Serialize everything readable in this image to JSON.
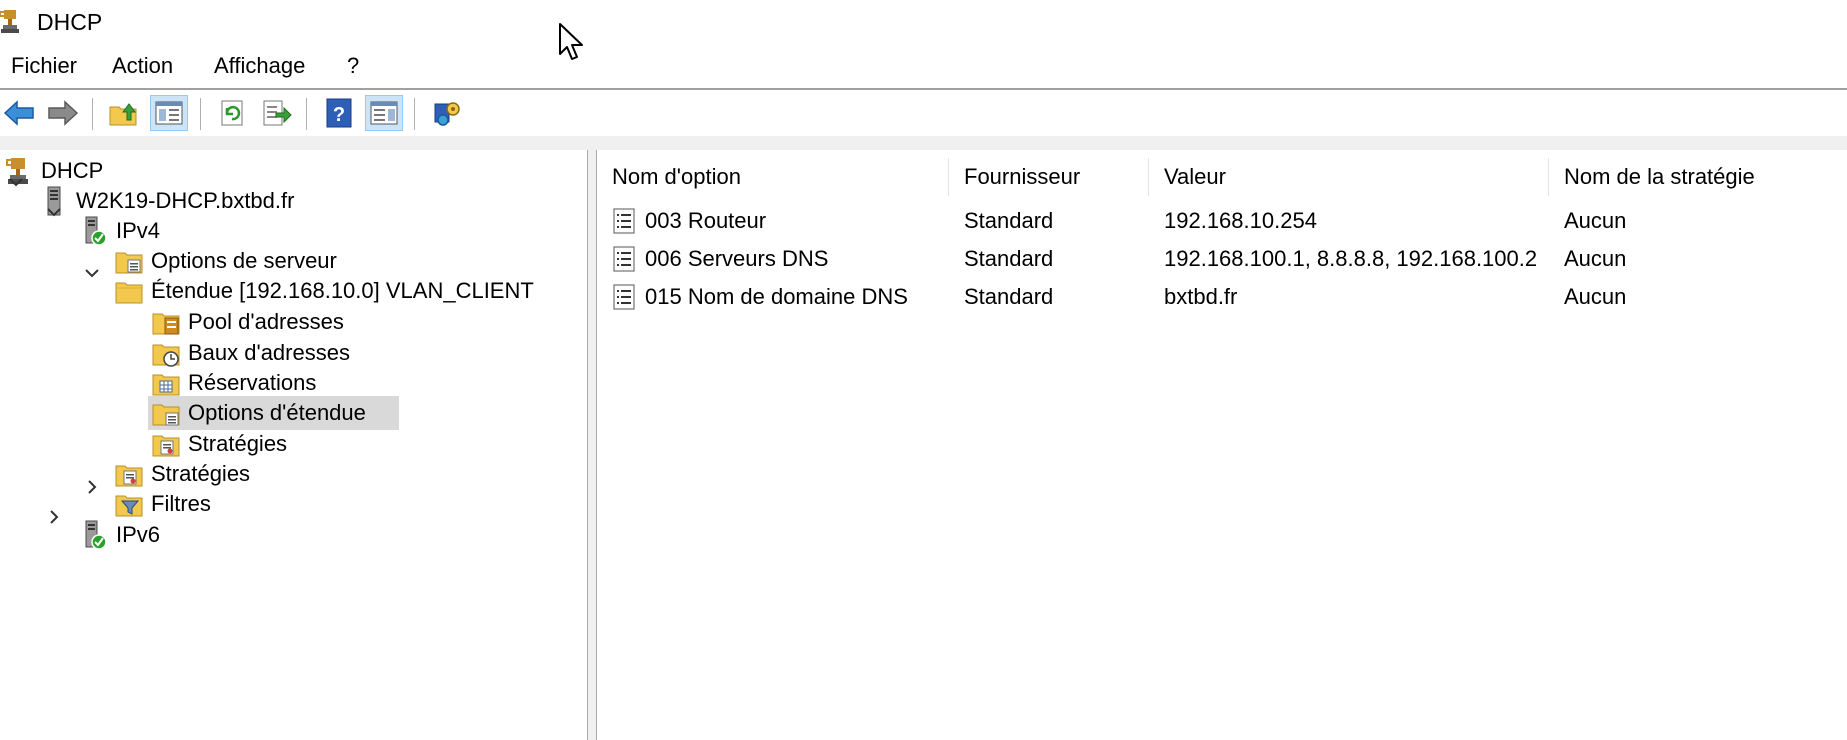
{
  "window": {
    "title": "DHCP",
    "icon": "dhcp-trophy-icon"
  },
  "menu": [
    "Fichier",
    "Action",
    "Affichage",
    "?"
  ],
  "toolbar": {
    "buttons": [
      {
        "name": "back-button",
        "icon": "arrow-left-icon"
      },
      {
        "name": "forward-button",
        "icon": "arrow-right-icon"
      },
      {
        "name": "up-level-button",
        "icon": "folder-up-icon"
      },
      {
        "name": "show-hide-tree-button",
        "icon": "console-tree-icon",
        "pressed": true
      },
      {
        "name": "refresh-button",
        "icon": "refresh-icon"
      },
      {
        "name": "export-list-button",
        "icon": "export-list-icon"
      },
      {
        "name": "help-button",
        "icon": "help-icon"
      },
      {
        "name": "show-hide-action-pane-button",
        "icon": "action-pane-icon",
        "pressed": true
      },
      {
        "name": "dhcp-tool-button",
        "icon": "dhcp-tool-icon"
      }
    ]
  },
  "tree": {
    "nodes": [
      {
        "label": "DHCP",
        "icon": "dhcp-trophy-icon",
        "expander": "none"
      },
      {
        "label": "W2K19-DHCP.bxtbd.fr",
        "icon": "server-icon",
        "expander": "expanded"
      },
      {
        "label": "IPv4",
        "icon": "server-check-icon",
        "expander": "expanded"
      },
      {
        "label": "Options de serveur",
        "icon": "folder-options-icon",
        "expander": "none"
      },
      {
        "label": "Étendue [192.168.10.0] VLAN_CLIENT",
        "icon": "folder-icon",
        "expander": "expanded"
      },
      {
        "label": "Pool d'adresses",
        "icon": "folder-pool-icon",
        "expander": "none"
      },
      {
        "label": "Baux d'adresses",
        "icon": "folder-clock-icon",
        "expander": "none"
      },
      {
        "label": "Réservations",
        "icon": "folder-grid-icon",
        "expander": "none"
      },
      {
        "label": "Options d'étendue",
        "icon": "folder-options-icon",
        "expander": "none",
        "selected": true
      },
      {
        "label": "Stratégies",
        "icon": "folder-policy-icon",
        "expander": "none"
      },
      {
        "label": "Stratégies",
        "icon": "folder-policy-icon",
        "expander": "none"
      },
      {
        "label": "Filtres",
        "icon": "folder-filter-icon",
        "expander": "collapsed"
      },
      {
        "label": "IPv6",
        "icon": "server-check-icon",
        "expander": "collapsed"
      }
    ]
  },
  "list": {
    "columns": [
      "Nom d'option",
      "Fournisseur",
      "Valeur",
      "Nom de la stratégie"
    ],
    "rows": [
      {
        "icon": "option-doc-icon",
        "cells": [
          "003 Routeur",
          "Standard",
          "192.168.10.254",
          "Aucun"
        ]
      },
      {
        "icon": "option-doc-icon",
        "cells": [
          "006 Serveurs DNS",
          "Standard",
          "192.168.100.1, 8.8.8.8, 192.168.100.2",
          "Aucun"
        ]
      },
      {
        "icon": "option-doc-icon",
        "cells": [
          "015 Nom de domaine DNS",
          "Standard",
          "bxtbd.fr",
          "Aucun"
        ]
      }
    ]
  },
  "colors": {
    "selection": "#d9d9d9",
    "pressed_button": "#cce4f7",
    "folder": "#f2c94c",
    "help_blue": "#2e5fb8"
  }
}
